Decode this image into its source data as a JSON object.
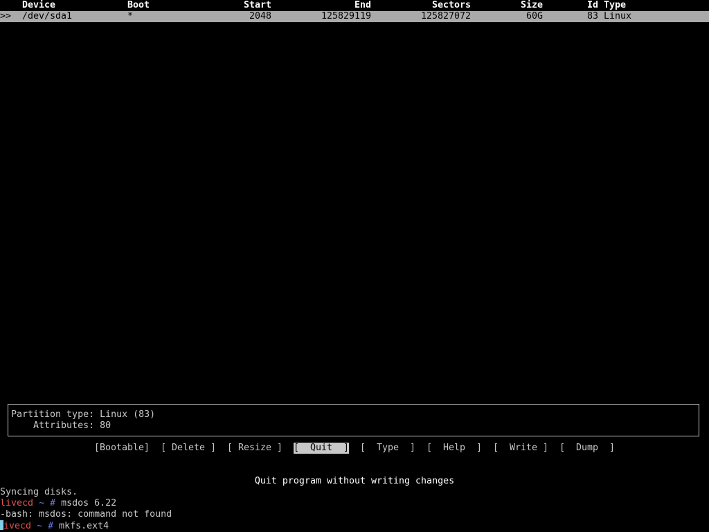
{
  "table": {
    "headers": {
      "device": "Device",
      "boot": "Boot",
      "start": "Start",
      "end": "End",
      "sectors": "Sectors",
      "size": "Size",
      "id_type": "Id Type"
    },
    "rows": [
      {
        "marker": ">>",
        "device": "/dev/sda1",
        "boot": "*",
        "start": "2048",
        "end": "125829119",
        "sectors": "125827072",
        "size": "60G",
        "id_type": "83 Linux"
      }
    ]
  },
  "info": {
    "partition_type": "Partition type: Linux (83)",
    "attributes": "    Attributes: 80"
  },
  "menu": {
    "items": [
      {
        "label": "[Bootable]",
        "selected": false
      },
      {
        "label": "[ Delete ]",
        "selected": false
      },
      {
        "label": "[ Resize ]",
        "selected": false
      },
      {
        "label": "[  Quit  ]",
        "selected": true
      },
      {
        "label": "[  Type  ]",
        "selected": false
      },
      {
        "label": "[  Help  ]",
        "selected": false
      },
      {
        "label": "[  Write ]",
        "selected": false
      },
      {
        "label": "[  Dump  ]",
        "selected": false
      }
    ],
    "hint": "Quit program without writing changes"
  },
  "terminal": {
    "sync_msg": "Syncing disks.",
    "host": "livecd",
    "tilde": "~",
    "hash": "#",
    "cmd1": "msdos 6.22",
    "error": "-bash: msdos: command not found",
    "host_rest": "ivecd",
    "cmd2": "mkfs.ext4"
  },
  "colors": {
    "selected_row_bg": "#aaaaaa",
    "prompt_host": "#e05050",
    "prompt_tilde": "#6a78e0",
    "cursor": "#7fd0e8"
  }
}
